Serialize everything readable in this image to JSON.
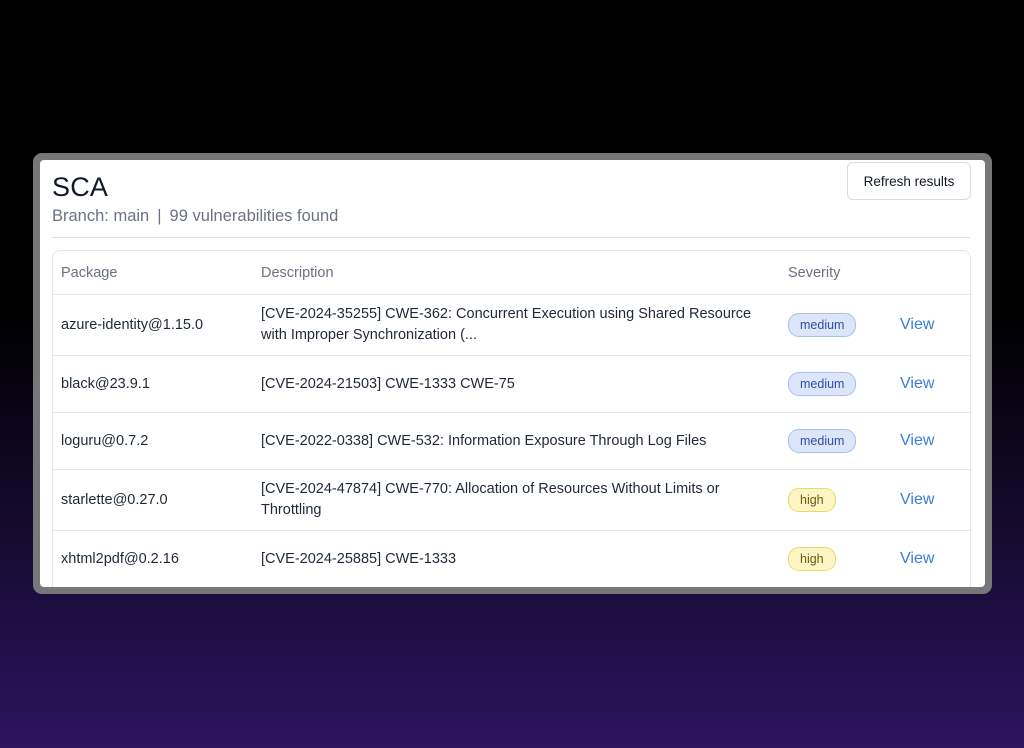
{
  "header": {
    "title": "SCA",
    "branch": "Branch: main",
    "separator": "|",
    "count": "99 vulnerabilities found",
    "refresh_label": "Refresh results"
  },
  "table": {
    "columns": [
      "Package",
      "Description",
      "Severity",
      ""
    ],
    "rows": [
      {
        "package": "azure-identity@1.15.0",
        "description": "[CVE-2024-35255] CWE-362: Concurrent Execution using Shared Resource with Improper Synchronization (...",
        "severity": "medium",
        "action": "View"
      },
      {
        "package": "black@23.9.1",
        "description": "[CVE-2024-21503] CWE-1333 CWE-75",
        "severity": "medium",
        "action": "View"
      },
      {
        "package": "loguru@0.7.2",
        "description": "[CVE-2022-0338] CWE-532: Information Exposure Through Log Files",
        "severity": "medium",
        "action": "View"
      },
      {
        "package": "starlette@0.27.0",
        "description": "[CVE-2024-47874] CWE-770: Allocation of Resources Without Limits or Throttling",
        "severity": "high",
        "action": "View"
      },
      {
        "package": "xhtml2pdf@0.2.16",
        "description": "[CVE-2024-25885] CWE-1333",
        "severity": "high",
        "action": "View"
      }
    ]
  },
  "colors": {
    "medium_bg": "#dbe6fb",
    "medium_text": "#2f4ea3",
    "high_bg": "#fdf6c4",
    "high_text": "#6b5a12",
    "link": "#3b7be0"
  }
}
